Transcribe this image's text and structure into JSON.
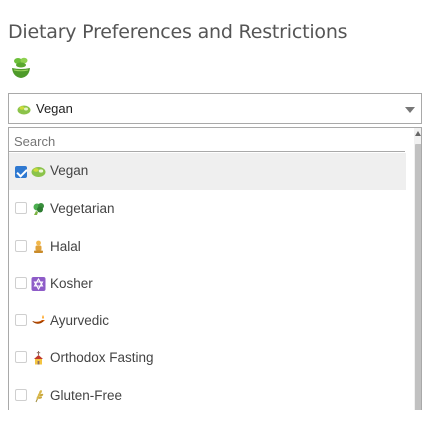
{
  "page": {
    "title": "Dietary Preferences and Restrictions",
    "header_icon": "salad-bowl-icon"
  },
  "select": {
    "selected_label": "Vegan",
    "selected_icon": "salad-icon"
  },
  "dropdown": {
    "search_placeholder": "Search",
    "options": [
      {
        "label": "Vegan",
        "icon": "salad-icon",
        "checked": true
      },
      {
        "label": "Vegetarian",
        "icon": "broccoli-icon",
        "checked": false
      },
      {
        "label": "Halal",
        "icon": "person-praying-icon",
        "checked": false
      },
      {
        "label": "Kosher",
        "icon": "star-of-david-icon",
        "checked": false
      },
      {
        "label": "Ayurvedic",
        "icon": "oil-lamp-icon",
        "checked": false
      },
      {
        "label": "Orthodox Fasting",
        "icon": "church-icon",
        "checked": false
      },
      {
        "label": "Gluten-Free",
        "icon": "wheat-icon",
        "checked": false
      }
    ]
  },
  "colors": {
    "accent": "#2f79d1",
    "border": "#a9a9a9",
    "selected_row": "#efefef",
    "scrollbar_thumb": "#c1c1c1"
  }
}
